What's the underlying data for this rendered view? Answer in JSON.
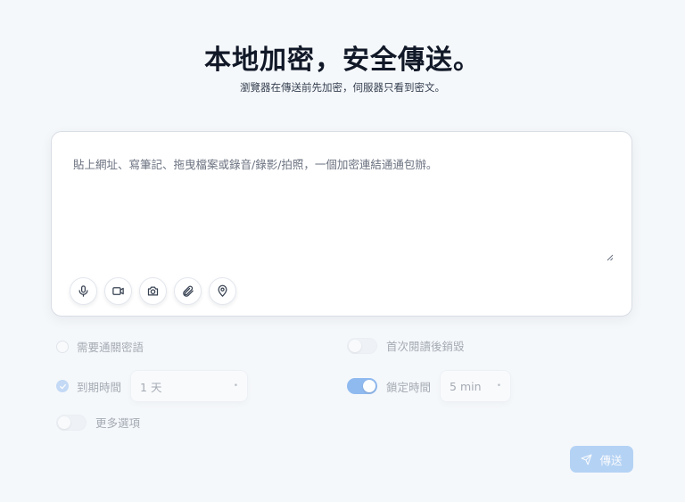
{
  "header": {
    "title": "本地加密，安全傳送。",
    "subtitle": "瀏覽器在傳送前先加密，伺服器只看到密文。"
  },
  "composer": {
    "placeholder": "貼上網址、寫筆記、拖曳檔案或錄音/錄影/拍照，一個加密連結通通包辦。",
    "value": "",
    "media_buttons": [
      {
        "icon": "microphone-icon"
      },
      {
        "icon": "video-camera-icon"
      },
      {
        "icon": "camera-icon"
      },
      {
        "icon": "paperclip-icon"
      },
      {
        "icon": "location-pin-icon"
      }
    ]
  },
  "options": {
    "passphrase": {
      "label": "需要通關密語",
      "checked": false
    },
    "burn_after_read": {
      "label": "首次閱讀後銷毀",
      "enabled": false
    },
    "expiry": {
      "label": "到期時間",
      "checked": true,
      "value": "1 天"
    },
    "lock_time": {
      "label": "鎖定時間",
      "enabled": true,
      "value": "5 min"
    },
    "more_options": {
      "label": "更多選項",
      "enabled": false
    }
  },
  "send": {
    "label": "傳送"
  },
  "colors": {
    "background": "#f5f8fb",
    "accent": "#7fb4ef",
    "text": "#111827"
  }
}
